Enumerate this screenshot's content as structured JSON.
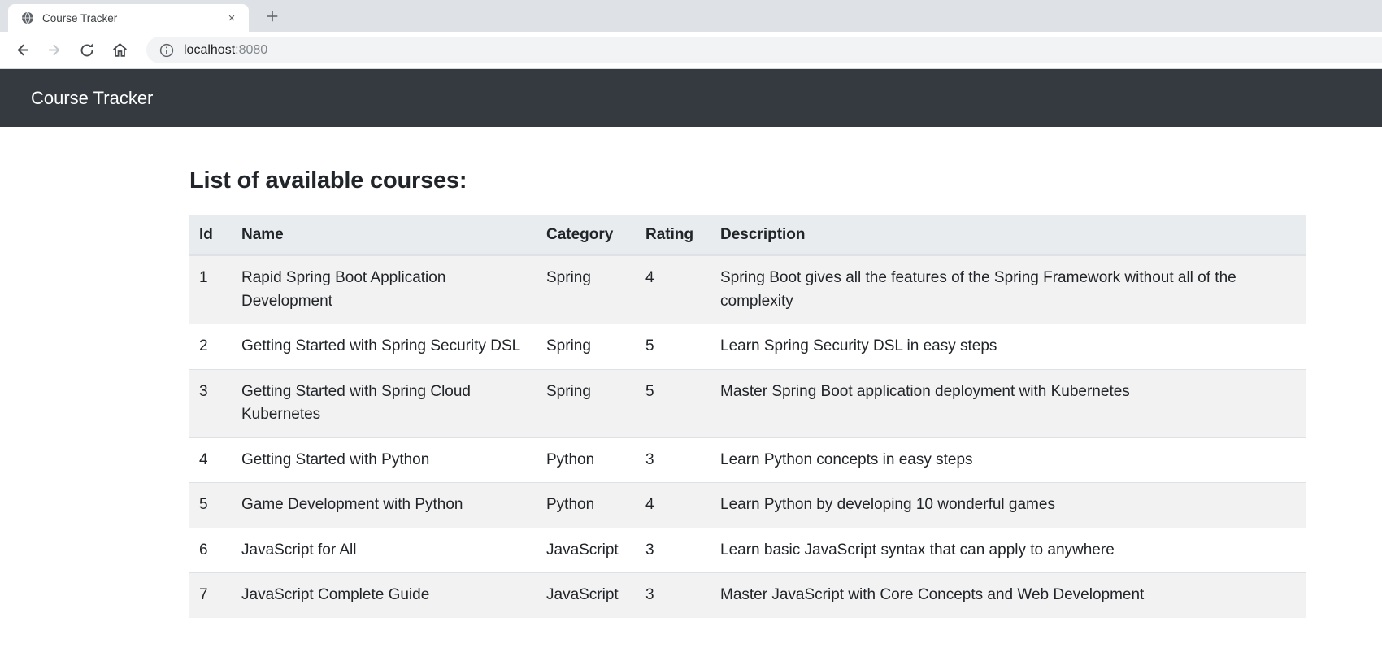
{
  "browser": {
    "tab_title": "Course Tracker",
    "url_host": "localhost",
    "url_port": ":8080",
    "close_tab_glyph": "×",
    "new_tab_glyph": "+"
  },
  "navbar": {
    "brand": "Course Tracker"
  },
  "page": {
    "heading": "List of available courses:"
  },
  "table": {
    "headers": [
      "Id",
      "Name",
      "Category",
      "Rating",
      "Description"
    ],
    "column_keys": [
      "id",
      "name",
      "category",
      "rating",
      "description"
    ],
    "rows": [
      {
        "id": "1",
        "name": "Rapid Spring Boot Application Development",
        "category": "Spring",
        "rating": "4",
        "description": "Spring Boot gives all the features of the Spring Framework without all of the complexity"
      },
      {
        "id": "2",
        "name": "Getting Started with Spring Security DSL",
        "category": "Spring",
        "rating": "5",
        "description": "Learn Spring Security DSL in easy steps"
      },
      {
        "id": "3",
        "name": "Getting Started with Spring Cloud Kubernetes",
        "category": "Spring",
        "rating": "5",
        "description": "Master Spring Boot application deployment with Kubernetes"
      },
      {
        "id": "4",
        "name": "Getting Started with Python",
        "category": "Python",
        "rating": "3",
        "description": "Learn Python concepts in easy steps"
      },
      {
        "id": "5",
        "name": "Game Development with Python",
        "category": "Python",
        "rating": "4",
        "description": "Learn Python by developing 10 wonderful games"
      },
      {
        "id": "6",
        "name": "JavaScript for All",
        "category": "JavaScript",
        "rating": "3",
        "description": "Learn basic JavaScript syntax that can apply to anywhere"
      },
      {
        "id": "7",
        "name": "JavaScript Complete Guide",
        "category": "JavaScript",
        "rating": "3",
        "description": "Master JavaScript with Core Concepts and Web Development"
      }
    ]
  },
  "colors": {
    "navbar_bg": "#343a40",
    "table_header_bg": "#e9ecef",
    "row_stripe_bg": "#f2f2f2",
    "tabstrip_bg": "#dee1e6",
    "addressbar_bg": "#f1f3f4"
  }
}
